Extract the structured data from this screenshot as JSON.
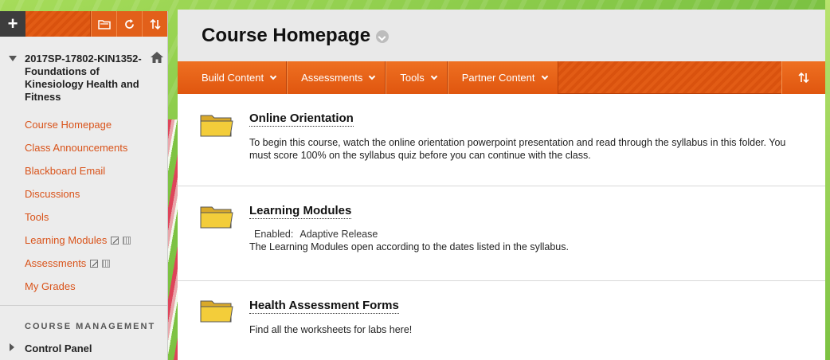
{
  "sidebar": {
    "toolbar": {
      "add_symbol": "+",
      "icons": [
        "folder-icon",
        "refresh-icon",
        "sort-icon"
      ]
    },
    "course_title": "2017SP-17802-KIN1352-Foundations of Kinesiology Health and Fitness",
    "links": [
      {
        "label": "Course Homepage"
      },
      {
        "label": "Class Announcements"
      },
      {
        "label": "Blackboard Email"
      },
      {
        "label": "Discussions"
      },
      {
        "label": "Tools"
      },
      {
        "label": "Learning Modules",
        "badges": [
          "edit-icon",
          "grid-icon"
        ]
      },
      {
        "label": "Assessments",
        "badges": [
          "edit-icon",
          "grid-icon"
        ]
      },
      {
        "label": "My Grades"
      }
    ],
    "management_heading": "COURSE MANAGEMENT",
    "control_panel": "Control Panel"
  },
  "page": {
    "title": "Course Homepage"
  },
  "actionbar": {
    "buttons": [
      {
        "label": "Build Content"
      },
      {
        "label": "Assessments"
      },
      {
        "label": "Tools"
      },
      {
        "label": "Partner Content"
      }
    ],
    "sort_symbol": "⇅"
  },
  "content_items": [
    {
      "title": "Online Orientation",
      "description": " To begin this course, watch the online orientation powerpoint presentation and read through the syllabus in this folder. You must score 100% on the syllabus quiz before you can continue with the class."
    },
    {
      "title": "Learning Modules",
      "detail_label": "Enabled:",
      "detail_value": "Adaptive Release",
      "description": "The Learning Modules open according to the dates listed in the syllabus."
    },
    {
      "title": "Health Assessment Forms",
      "description": "Find all the worksheets for labs here!"
    }
  ],
  "colors": {
    "accent": "#e15a13",
    "link": "#d9531a",
    "background": "#8fd14f"
  }
}
